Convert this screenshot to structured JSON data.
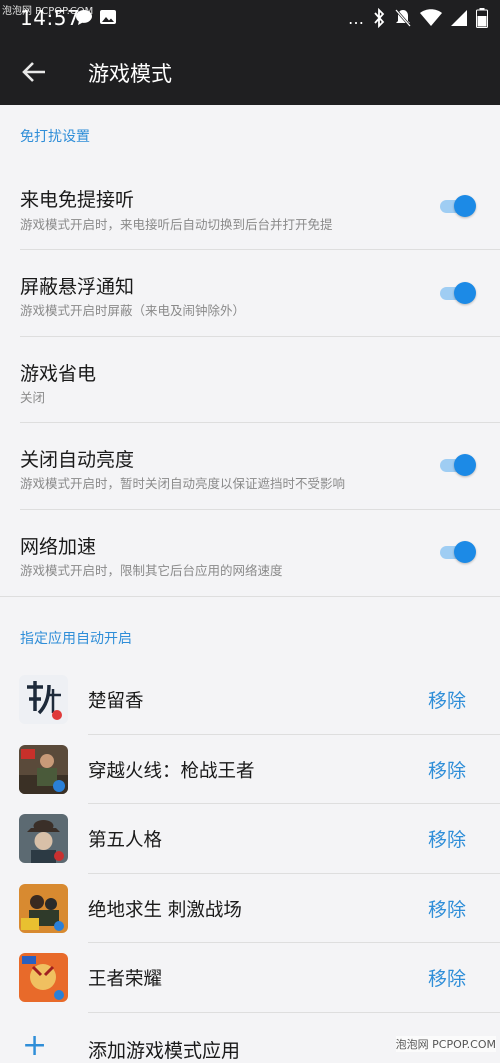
{
  "status": {
    "time": "14:57",
    "watermark": "泡泡网 PCPOP.COM"
  },
  "appbar": {
    "title": "游戏模式"
  },
  "section1": {
    "header": "免打扰设置"
  },
  "settings": [
    {
      "title": "来电免提接听",
      "sub": "游戏模式开启时，来电接听后自动切换到后台并打开免提",
      "toggle": true
    },
    {
      "title": "屏蔽悬浮通知",
      "sub": "游戏模式开启时屏蔽（来电及闹钟除外）",
      "toggle": true
    },
    {
      "title": "游戏省电",
      "sub": "关闭",
      "toggle": false
    },
    {
      "title": "关闭自动亮度",
      "sub": "游戏模式开启时，暂时关闭自动亮度以保证遮挡时不受影响",
      "toggle": true
    },
    {
      "title": "网络加速",
      "sub": "游戏模式开启时，限制其它后台应用的网络速度",
      "toggle": true
    }
  ],
  "section2": {
    "header": "指定应用自动开启"
  },
  "apps": [
    {
      "name": "楚留香",
      "action": "移除"
    },
    {
      "name": "穿越火线：枪战王者",
      "action": "移除"
    },
    {
      "name": "第五人格",
      "action": "移除"
    },
    {
      "name": "绝地求生 刺激战场",
      "action": "移除"
    },
    {
      "name": "王者荣耀",
      "action": "移除"
    }
  ],
  "add": {
    "label": "添加游戏模式应用"
  },
  "footer": {
    "watermark": "泡泡网 PCPOP.COM"
  },
  "colors": {
    "accent": "#2f8ed8",
    "toggle_on": "#1c8ae6",
    "bar": "#1f1f21"
  }
}
